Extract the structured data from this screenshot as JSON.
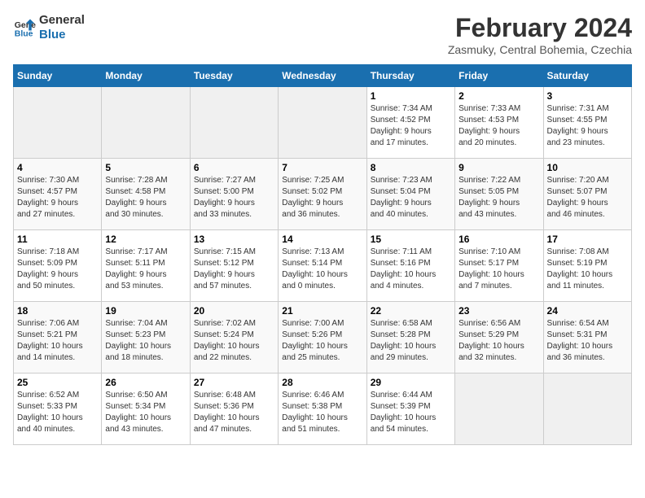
{
  "header": {
    "logo_line1": "General",
    "logo_line2": "Blue",
    "month": "February 2024",
    "location": "Zasmuky, Central Bohemia, Czechia"
  },
  "days_of_week": [
    "Sunday",
    "Monday",
    "Tuesday",
    "Wednesday",
    "Thursday",
    "Friday",
    "Saturday"
  ],
  "weeks": [
    [
      {
        "day": "",
        "info": ""
      },
      {
        "day": "",
        "info": ""
      },
      {
        "day": "",
        "info": ""
      },
      {
        "day": "",
        "info": ""
      },
      {
        "day": "1",
        "info": "Sunrise: 7:34 AM\nSunset: 4:52 PM\nDaylight: 9 hours\nand 17 minutes."
      },
      {
        "day": "2",
        "info": "Sunrise: 7:33 AM\nSunset: 4:53 PM\nDaylight: 9 hours\nand 20 minutes."
      },
      {
        "day": "3",
        "info": "Sunrise: 7:31 AM\nSunset: 4:55 PM\nDaylight: 9 hours\nand 23 minutes."
      }
    ],
    [
      {
        "day": "4",
        "info": "Sunrise: 7:30 AM\nSunset: 4:57 PM\nDaylight: 9 hours\nand 27 minutes."
      },
      {
        "day": "5",
        "info": "Sunrise: 7:28 AM\nSunset: 4:58 PM\nDaylight: 9 hours\nand 30 minutes."
      },
      {
        "day": "6",
        "info": "Sunrise: 7:27 AM\nSunset: 5:00 PM\nDaylight: 9 hours\nand 33 minutes."
      },
      {
        "day": "7",
        "info": "Sunrise: 7:25 AM\nSunset: 5:02 PM\nDaylight: 9 hours\nand 36 minutes."
      },
      {
        "day": "8",
        "info": "Sunrise: 7:23 AM\nSunset: 5:04 PM\nDaylight: 9 hours\nand 40 minutes."
      },
      {
        "day": "9",
        "info": "Sunrise: 7:22 AM\nSunset: 5:05 PM\nDaylight: 9 hours\nand 43 minutes."
      },
      {
        "day": "10",
        "info": "Sunrise: 7:20 AM\nSunset: 5:07 PM\nDaylight: 9 hours\nand 46 minutes."
      }
    ],
    [
      {
        "day": "11",
        "info": "Sunrise: 7:18 AM\nSunset: 5:09 PM\nDaylight: 9 hours\nand 50 minutes."
      },
      {
        "day": "12",
        "info": "Sunrise: 7:17 AM\nSunset: 5:11 PM\nDaylight: 9 hours\nand 53 minutes."
      },
      {
        "day": "13",
        "info": "Sunrise: 7:15 AM\nSunset: 5:12 PM\nDaylight: 9 hours\nand 57 minutes."
      },
      {
        "day": "14",
        "info": "Sunrise: 7:13 AM\nSunset: 5:14 PM\nDaylight: 10 hours\nand 0 minutes."
      },
      {
        "day": "15",
        "info": "Sunrise: 7:11 AM\nSunset: 5:16 PM\nDaylight: 10 hours\nand 4 minutes."
      },
      {
        "day": "16",
        "info": "Sunrise: 7:10 AM\nSunset: 5:17 PM\nDaylight: 10 hours\nand 7 minutes."
      },
      {
        "day": "17",
        "info": "Sunrise: 7:08 AM\nSunset: 5:19 PM\nDaylight: 10 hours\nand 11 minutes."
      }
    ],
    [
      {
        "day": "18",
        "info": "Sunrise: 7:06 AM\nSunset: 5:21 PM\nDaylight: 10 hours\nand 14 minutes."
      },
      {
        "day": "19",
        "info": "Sunrise: 7:04 AM\nSunset: 5:23 PM\nDaylight: 10 hours\nand 18 minutes."
      },
      {
        "day": "20",
        "info": "Sunrise: 7:02 AM\nSunset: 5:24 PM\nDaylight: 10 hours\nand 22 minutes."
      },
      {
        "day": "21",
        "info": "Sunrise: 7:00 AM\nSunset: 5:26 PM\nDaylight: 10 hours\nand 25 minutes."
      },
      {
        "day": "22",
        "info": "Sunrise: 6:58 AM\nSunset: 5:28 PM\nDaylight: 10 hours\nand 29 minutes."
      },
      {
        "day": "23",
        "info": "Sunrise: 6:56 AM\nSunset: 5:29 PM\nDaylight: 10 hours\nand 32 minutes."
      },
      {
        "day": "24",
        "info": "Sunrise: 6:54 AM\nSunset: 5:31 PM\nDaylight: 10 hours\nand 36 minutes."
      }
    ],
    [
      {
        "day": "25",
        "info": "Sunrise: 6:52 AM\nSunset: 5:33 PM\nDaylight: 10 hours\nand 40 minutes."
      },
      {
        "day": "26",
        "info": "Sunrise: 6:50 AM\nSunset: 5:34 PM\nDaylight: 10 hours\nand 43 minutes."
      },
      {
        "day": "27",
        "info": "Sunrise: 6:48 AM\nSunset: 5:36 PM\nDaylight: 10 hours\nand 47 minutes."
      },
      {
        "day": "28",
        "info": "Sunrise: 6:46 AM\nSunset: 5:38 PM\nDaylight: 10 hours\nand 51 minutes."
      },
      {
        "day": "29",
        "info": "Sunrise: 6:44 AM\nSunset: 5:39 PM\nDaylight: 10 hours\nand 54 minutes."
      },
      {
        "day": "",
        "info": ""
      },
      {
        "day": "",
        "info": ""
      }
    ]
  ]
}
